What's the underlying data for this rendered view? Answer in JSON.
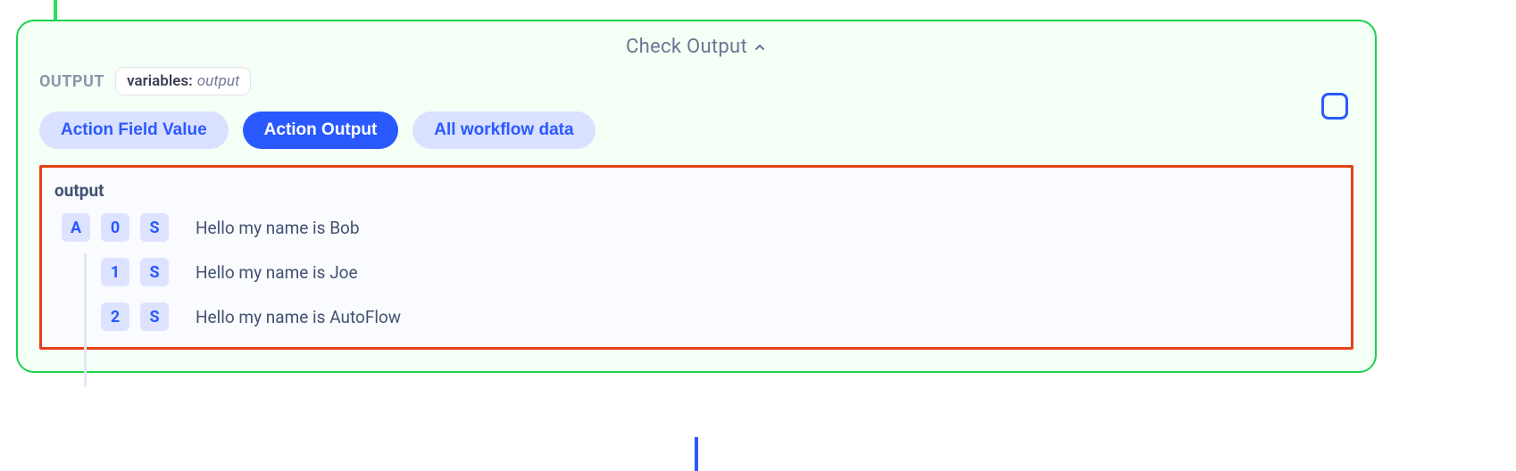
{
  "panel": {
    "title": "Check Output",
    "outputLabel": "OUTPUT",
    "chip": {
      "key": "variables:",
      "value": "output"
    }
  },
  "tabs": {
    "fieldValue": "Action Field Value",
    "actionOutput": "Action Output",
    "allData": "All workflow data"
  },
  "outputBox": {
    "heading": "output",
    "rows": [
      {
        "a": "A",
        "idx": "0",
        "s": "S",
        "text": "Hello my name is Bob"
      },
      {
        "a": "",
        "idx": "1",
        "s": "S",
        "text": "Hello my name is Joe"
      },
      {
        "a": "",
        "idx": "2",
        "s": "S",
        "text": "Hello my name is AutoFlow"
      }
    ]
  }
}
